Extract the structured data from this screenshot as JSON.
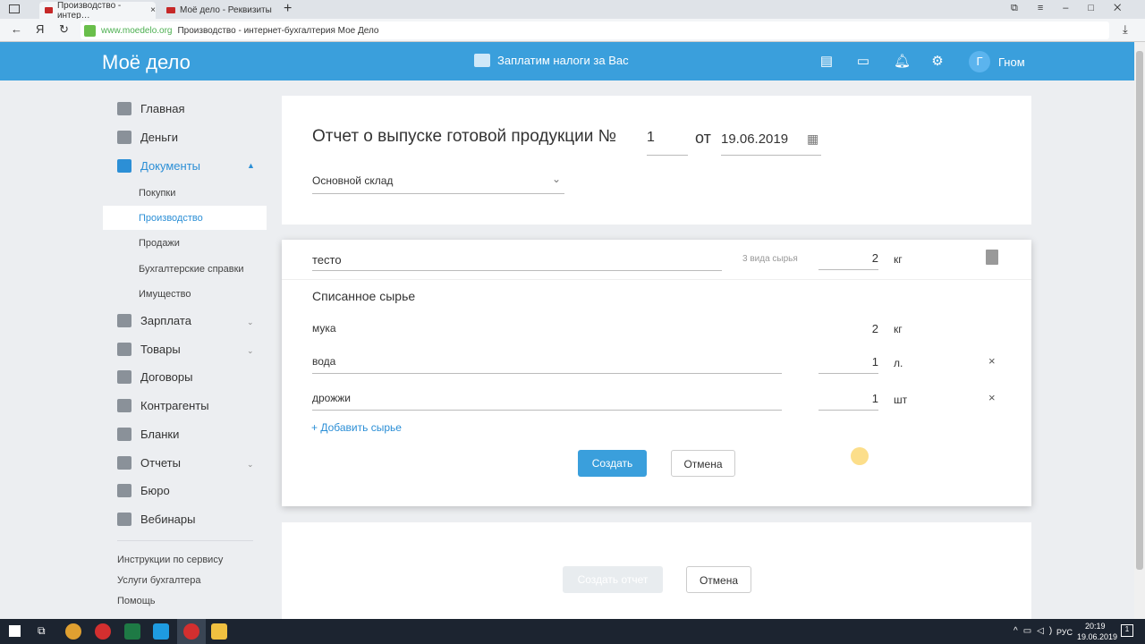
{
  "browser": {
    "tabs": [
      {
        "label": "Производство - интер…",
        "active": true
      },
      {
        "label": "Моё дело - Реквизиты",
        "active": false
      }
    ],
    "url_domain": "www.moedelo.org",
    "url_title": "Производство - интернет-бухгалтерия Мое Дело"
  },
  "header": {
    "logo": "Моё дело",
    "pay_taxes": "Заплатим налоги за Вас",
    "avatar_letter": "Г",
    "user": "Гном",
    "accent": "#3a9fdc"
  },
  "sidebar": {
    "items": [
      {
        "label": "Главная"
      },
      {
        "label": "Деньги"
      },
      {
        "label": "Документы",
        "active": true
      },
      {
        "label": "Зарплата"
      },
      {
        "label": "Товары"
      },
      {
        "label": "Договоры"
      },
      {
        "label": "Контрагенты"
      },
      {
        "label": "Бланки"
      },
      {
        "label": "Отчеты"
      },
      {
        "label": "Бюро"
      },
      {
        "label": "Вебинары"
      }
    ],
    "sub_items": [
      "Покупки",
      "Производство",
      "Продажи",
      "Бухгалтерские справки",
      "Имущество"
    ],
    "footer_links": [
      "Инструкции по сервису",
      "Услуги бухгалтера",
      "Помощь"
    ]
  },
  "report": {
    "title": "Отчет о выпуске готовой продукции №",
    "number": "1",
    "from": "от",
    "date": "19.06.2019",
    "warehouse": "Основной склад"
  },
  "product": {
    "name": "тесто",
    "materials_count": "3 вида сырья",
    "qty": "2",
    "unit": "кг",
    "section_title": "Списанное сырье",
    "materials": [
      {
        "name": "мука",
        "qty": "2",
        "unit": "кг"
      },
      {
        "name": "вода",
        "qty": "1",
        "unit": "л."
      },
      {
        "name": "дрожжи",
        "qty": "1",
        "unit": "шт"
      }
    ],
    "add_material": "+ Добавить сырье",
    "create": "Создать",
    "cancel": "Отмена",
    "remove": "×"
  },
  "footer": {
    "create_report": "Создать отчет",
    "cancel": "Отмена"
  },
  "taskbar": {
    "lang": "РУС",
    "time": "20:19",
    "date": "19.06.2019",
    "notifications": "1"
  }
}
